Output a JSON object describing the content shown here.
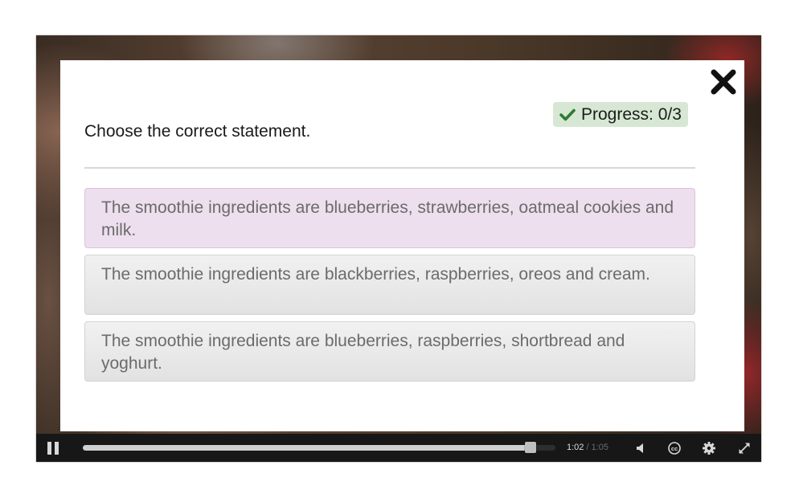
{
  "dialog": {
    "question": "Choose the correct statement.",
    "progress_label": "Progress: 0/3",
    "answers": [
      {
        "text": "The smoothie ingredients are blueberries, strawberries, oatmeal cookies and milk.",
        "selected": true
      },
      {
        "text": "The smoothie ingredients are blackberries, raspberries, oreos and cream.",
        "selected": false
      },
      {
        "text": "The smoothie ingredients are blueberries, raspberries, shortbread and yoghurt.",
        "selected": false
      }
    ],
    "close_icon": "close-icon"
  },
  "player": {
    "current_time": "1:02",
    "separator": " / ",
    "total_time": "1:05",
    "progress_fraction": 0.947,
    "icons": [
      "pause-icon",
      "volume-icon",
      "closed-captions-icon",
      "gear-icon",
      "fullscreen-icon"
    ]
  },
  "colors": {
    "progress_badge": "#d6e7d3",
    "checkmark": "#2f7a34",
    "selected_answer": "#eddfee",
    "control_bar": "#171717"
  }
}
